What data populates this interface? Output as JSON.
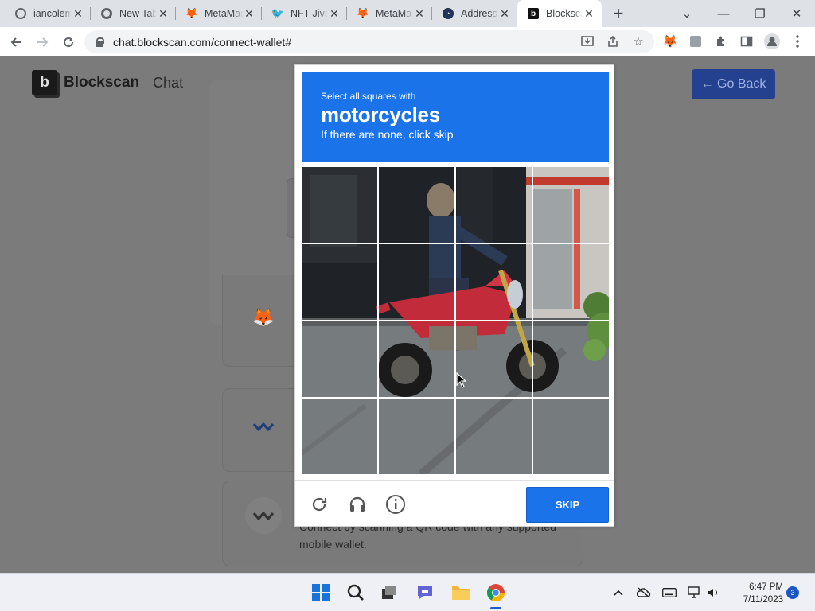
{
  "tabs": [
    {
      "label": "iancolema",
      "favicon": "globe-icon"
    },
    {
      "label": "New Tab",
      "favicon": "chrome-icon"
    },
    {
      "label": "MetaMask",
      "favicon": "metamask-fox-icon"
    },
    {
      "label": "NFT Jiva",
      "favicon": "twitter-bird-icon"
    },
    {
      "label": "MetaMask",
      "favicon": "metamask-fox-icon"
    },
    {
      "label": "Address",
      "favicon": "etherscan-icon"
    },
    {
      "label": "Blockscan",
      "favicon": "blockscan-icon",
      "active": true
    }
  ],
  "browser": {
    "url": "chat.blockscan.com/connect-wallet#",
    "new_tab": "+",
    "min": "—",
    "restore": "❐",
    "close": "✕",
    "tab_search": "⌄"
  },
  "page": {
    "logo_mark": "b",
    "logo_text": "Blockscan",
    "logo_section": "Chat",
    "go_back": "← Go Back",
    "wallet_option_desc": "Connect by scanning a QR code with any supported mobile wallet."
  },
  "captcha": {
    "instruction_line1": "Select all squares with",
    "target_word": "motorcycles",
    "instruction_line3": "If there are none, click skip",
    "skip_label": "SKIP",
    "grid_size": 4,
    "icons": [
      "refresh-icon",
      "audio-challenge-icon",
      "info-icon"
    ]
  },
  "taskbar": {
    "time": "6:47 PM",
    "date": "7/11/2023",
    "notifications": "3"
  },
  "colors": {
    "captcha_blue": "#1a73e8",
    "go_back_bg": "#24418f",
    "tabstrip": "#dee1e6",
    "overlay": "#7b7b7b"
  }
}
